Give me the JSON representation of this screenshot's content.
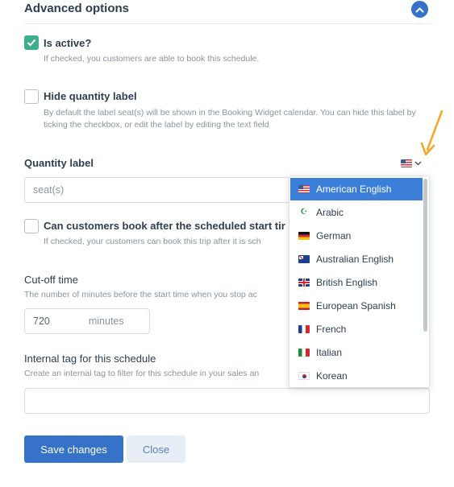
{
  "section": {
    "title": "Advanced options"
  },
  "options": {
    "is_active": {
      "title": "Is active?",
      "description": "If checked, you customers are able to book this schedule.",
      "checked": true
    },
    "hide_quantity": {
      "title": "Hide quantity label",
      "description": "By default the label seat(s) will be shown in the Booking Widget calendar. You can hide this label by ticking the checkbox, or edit the label by editing the text field",
      "checked": false
    },
    "book_after_start": {
      "title": "Can customers book after the scheduled start tir",
      "description": "If checked, your customers can book this trip after it is sch",
      "checked": false
    }
  },
  "quantity_label": {
    "label": "Quantity label",
    "value": "seat(s)",
    "selected_language_icon": "flag-us-icon"
  },
  "cutoff": {
    "label": "Cut-off time",
    "help": "The number of minutes before the start time when you stop ac",
    "value": "720",
    "unit": "minutes"
  },
  "internal_tag": {
    "label": "Internal tag for this schedule",
    "help": "Create an internal tag to filter for this schedule in your sales an",
    "value": ""
  },
  "language_menu": {
    "items": [
      {
        "label": "American English",
        "icon": "flag-us-icon",
        "active": true
      },
      {
        "label": "Arabic",
        "icon": "flag-ar-icon",
        "active": false
      },
      {
        "label": "German",
        "icon": "flag-de-icon",
        "active": false
      },
      {
        "label": "Australian English",
        "icon": "flag-au-icon",
        "active": false
      },
      {
        "label": "British English",
        "icon": "flag-gb-icon",
        "active": false
      },
      {
        "label": "European Spanish",
        "icon": "flag-es-icon",
        "active": false
      },
      {
        "label": "French",
        "icon": "flag-fr-icon",
        "active": false
      },
      {
        "label": "Italian",
        "icon": "flag-it-icon",
        "active": false
      },
      {
        "label": "Korean",
        "icon": "flag-kr-icon",
        "active": false
      }
    ]
  },
  "buttons": {
    "save": "Save changes",
    "close": "Close"
  },
  "colors": {
    "primary": "#3572c8",
    "checked": "#3fae8c",
    "annotation_arrow": "#f5a623"
  }
}
